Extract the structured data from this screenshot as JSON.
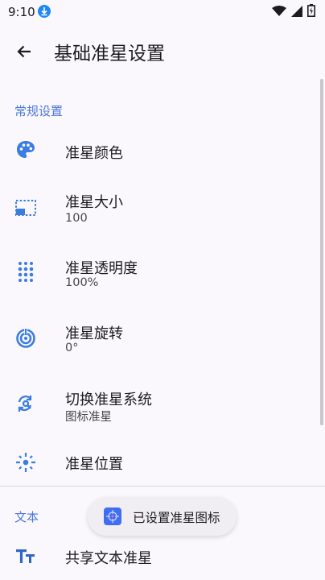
{
  "status_bar": {
    "time": "9:10",
    "icons": [
      "download-icon",
      "wifi-icon",
      "signal-icon",
      "battery-icon"
    ]
  },
  "app_bar": {
    "back_icon": "arrow-back-icon",
    "title": "基础准星设置"
  },
  "sections": [
    {
      "title": "常规设置",
      "items": [
        {
          "icon": "palette-icon",
          "label": "准星颜色"
        },
        {
          "icon": "resize-icon",
          "label": "准星大小",
          "summary": "100"
        },
        {
          "icon": "opacity-dots-icon",
          "label": "准星透明度",
          "summary": "100%"
        },
        {
          "icon": "rotate-icon",
          "label": "准星旋转",
          "summary": "0°"
        },
        {
          "icon": "switch-search-icon",
          "label": "切换准星系统",
          "summary": "图标准星"
        },
        {
          "icon": "crosshair-position-icon",
          "label": "准星位置"
        }
      ]
    },
    {
      "title": "文本",
      "items": [
        {
          "icon": "text-format-icon",
          "label": "共享文本准星"
        }
      ]
    }
  ],
  "toast": {
    "text": "已设置准星图标"
  },
  "colors": {
    "accent": "#4a78d8",
    "icon_blue": "#3b7de0",
    "background": "#fbf8fd"
  }
}
